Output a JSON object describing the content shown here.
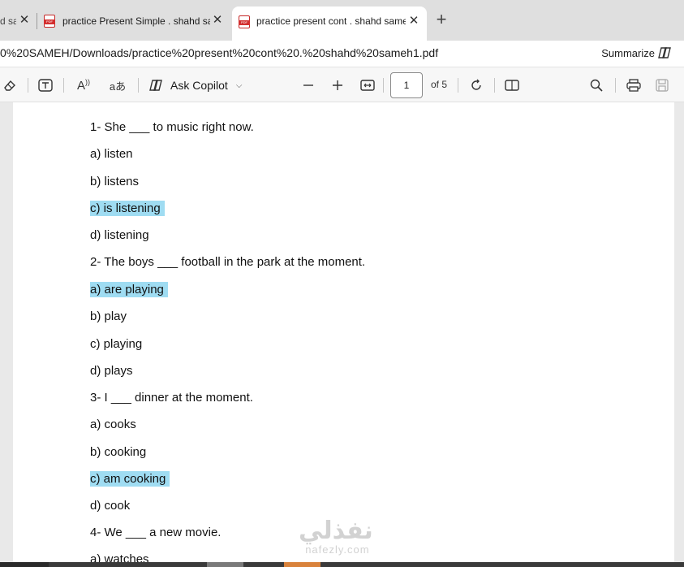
{
  "tabs": [
    {
      "title": "d sar",
      "active": false
    },
    {
      "title": "practice Present Simple . shahd sar",
      "active": false
    },
    {
      "title": "practice present cont . shahd same",
      "active": true
    }
  ],
  "address": {
    "url": "0%20SAMEH/Downloads/practice%20present%20cont%20.%20shahd%20sameh1.pdf",
    "summarize_label": "Summarize"
  },
  "toolbar": {
    "ask_copilot_label": "Ask Copilot",
    "page_number": "1",
    "page_of": "of 5",
    "read_aloud_glyph": "A",
    "translate_glyph": "aあ"
  },
  "document": {
    "lines": [
      {
        "text": "1- She ___ to music right now.",
        "highlight": false
      },
      {
        "text": "a) listen",
        "highlight": false
      },
      {
        "text": "b) listens",
        "highlight": false
      },
      {
        "text": "c) is listening",
        "highlight": true
      },
      {
        "text": "d) listening",
        "highlight": false
      },
      {
        "text": "2- The boys ___ football in the park at the moment.",
        "highlight": false
      },
      {
        "text": "a) are playing",
        "highlight": true
      },
      {
        "text": "b) play",
        "highlight": false
      },
      {
        "text": "c) playing",
        "highlight": false
      },
      {
        "text": "d) plays",
        "highlight": false
      },
      {
        "text": "3- I ___ dinner at the moment.",
        "highlight": false
      },
      {
        "text": "a) cooks",
        "highlight": false
      },
      {
        "text": "b) cooking",
        "highlight": false
      },
      {
        "text": "c) am cooking",
        "highlight": true
      },
      {
        "text": "d) cook",
        "highlight": false
      },
      {
        "text": "4- We ___ a new movie.",
        "highlight": false
      },
      {
        "text": "a) watches",
        "highlight": false
      }
    ]
  },
  "watermark": {
    "arabic": "نفذلي",
    "latin": "nafezly.com"
  },
  "colors": {
    "highlight": "#9fdcf2",
    "pdf_icon": "#d32f2f"
  }
}
